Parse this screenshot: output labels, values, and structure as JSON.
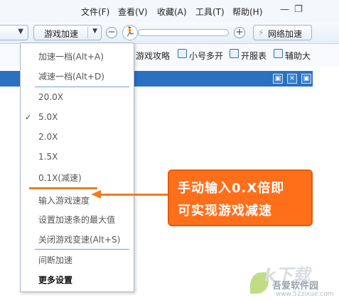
{
  "menubar": {
    "items": [
      "文件(F)",
      "查看(V)",
      "收藏(A)",
      "工具(T)",
      "帮助(H)"
    ],
    "minimize": "—",
    "maximize": "❐"
  },
  "toolbar": {
    "left_arrow": "▼",
    "speed_combo": "游戏加速",
    "speed_combo_arrow": "▼",
    "minus": "−",
    "plus": "+",
    "runner": "🏃",
    "network_icon": "⚡",
    "network": "网络加速"
  },
  "links": {
    "items": [
      "游戏攻略",
      "小号多开",
      "开服表",
      "辅助大"
    ]
  },
  "bluebar": {
    "icons": [
      "▣",
      "✕",
      "▣"
    ]
  },
  "dropdown": {
    "items": [
      {
        "label": "加速一档(Alt+A)",
        "checked": false
      },
      {
        "label": "减速一档(Alt+D)",
        "checked": false
      },
      {
        "label": "20.0X",
        "checked": false
      },
      {
        "label": "5.0X",
        "checked": true
      },
      {
        "label": "2.0X",
        "checked": false
      },
      {
        "label": "1.5X",
        "checked": false
      },
      {
        "label": "0.1X(减速)",
        "checked": false
      },
      {
        "label": "输入游戏速度",
        "checked": false
      },
      {
        "label": "设置加速条的最大值",
        "checked": false
      },
      {
        "label": "关闭游戏变速(Alt+S)",
        "checked": false
      },
      {
        "label": "间断加速",
        "checked": false
      },
      {
        "label": "更多设置",
        "checked": false
      }
    ],
    "check_mark": "✓"
  },
  "callout": {
    "lines": [
      "手动输入0.X倍即",
      "可实现游戏减速"
    ],
    "accent": "#ff6f1a"
  },
  "watermark": {
    "big": "k下载",
    "name": "吾爱软件园",
    "url": "www.52zixue.com"
  }
}
